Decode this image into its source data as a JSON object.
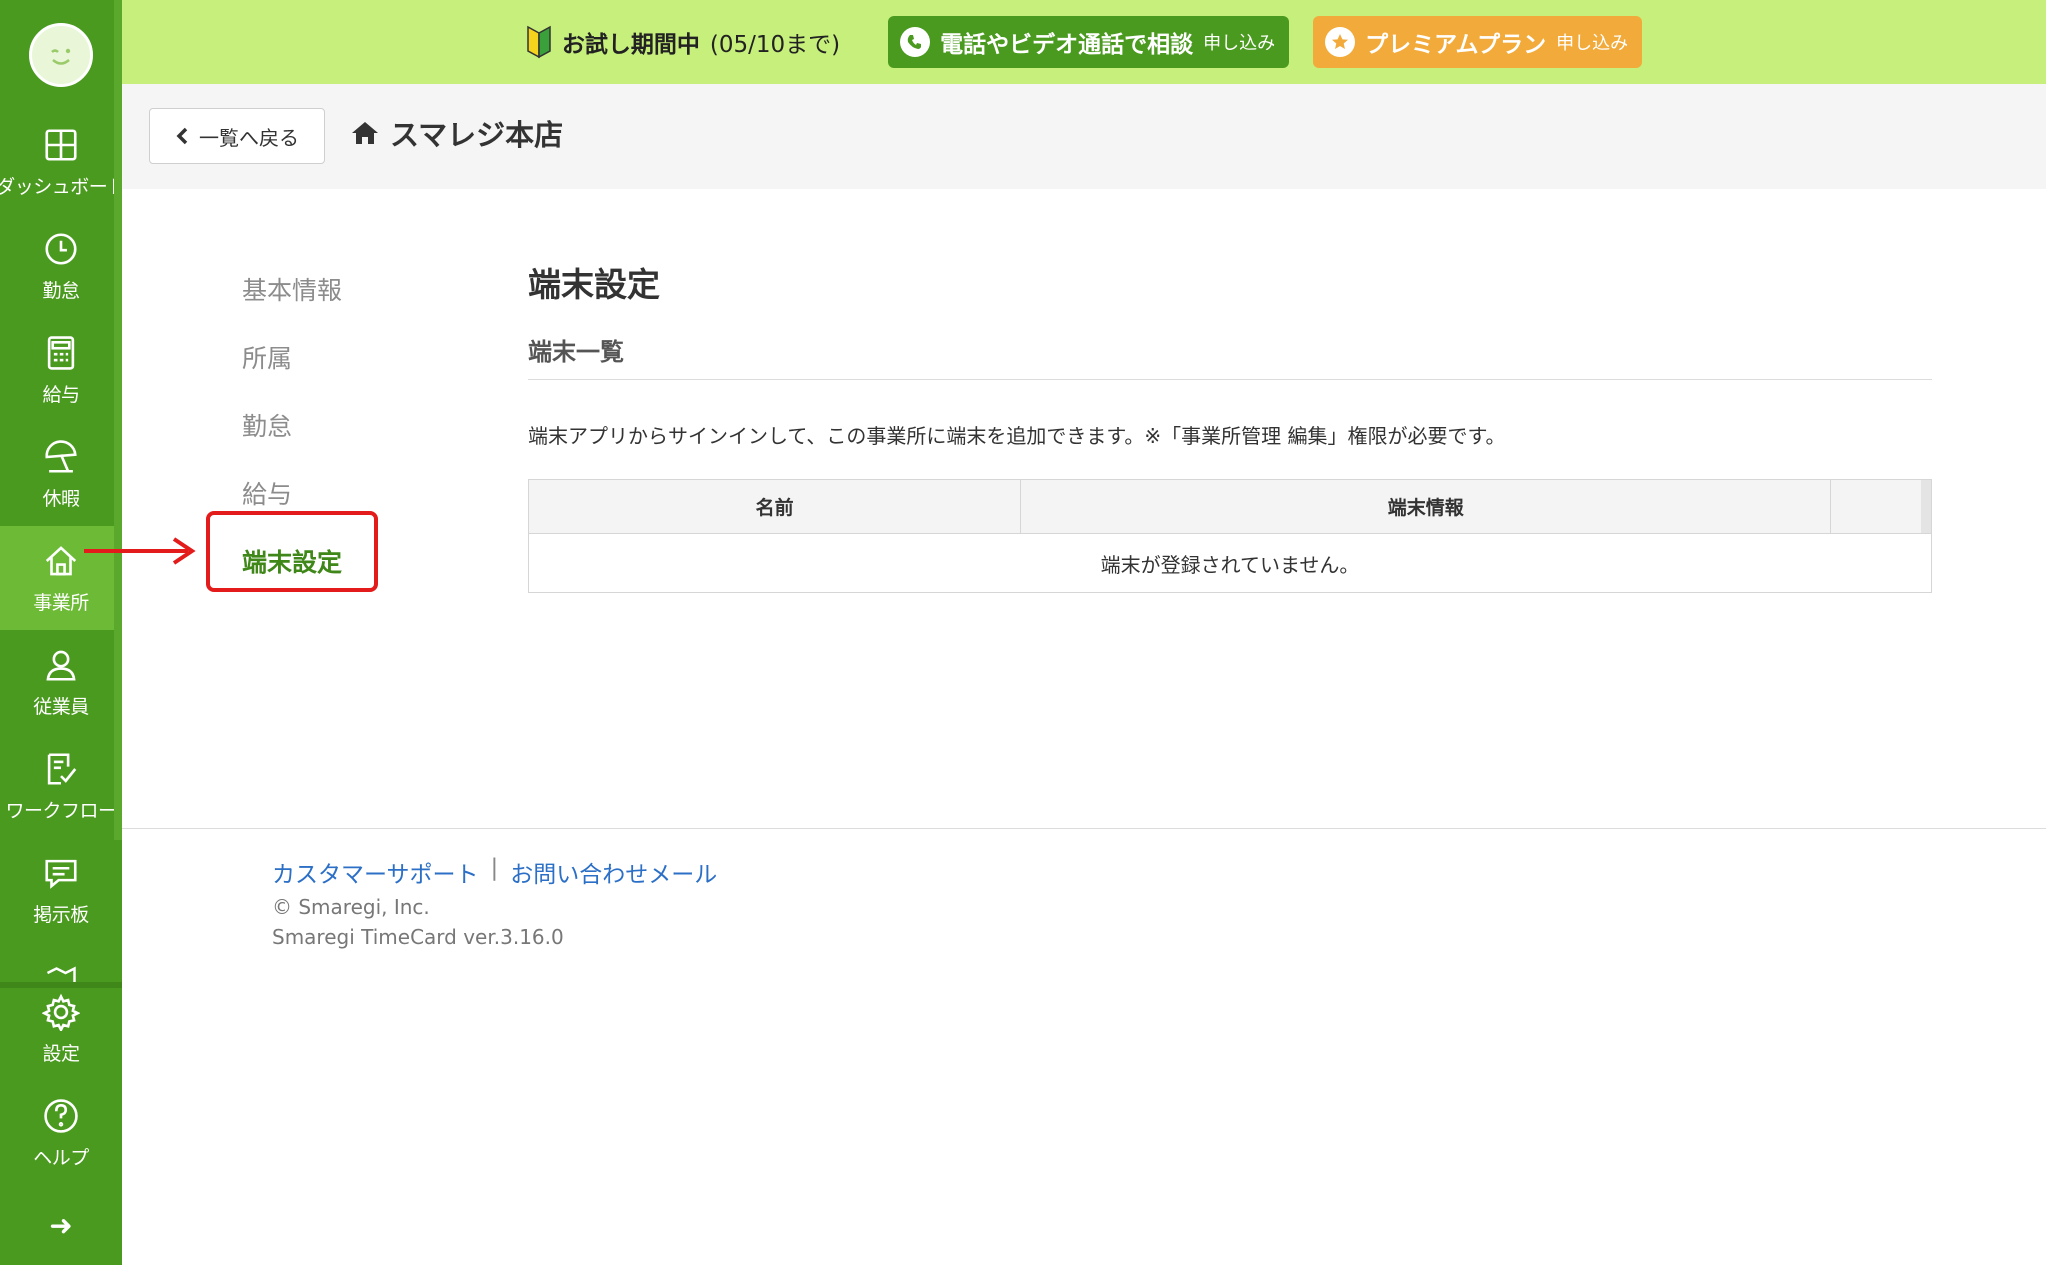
{
  "banner": {
    "trial_label": "お試し期間中",
    "trial_until": "(05/10まで)",
    "consult_label": "電話やビデオ通話で相談",
    "consult_sub": "申し込み",
    "premium_label": "プレミアムプラン",
    "premium_sub": "申し込み",
    "bg_color": "#c7ef7c",
    "green_color": "#4a9a1f",
    "orange_color": "#f2aa3a"
  },
  "sidebar": {
    "items": [
      {
        "label": "ダッシュボード",
        "icon": "dashboard-icon"
      },
      {
        "label": "勤怠",
        "icon": "clock-icon"
      },
      {
        "label": "給与",
        "icon": "calculator-icon"
      },
      {
        "label": "休暇",
        "icon": "umbrella-icon"
      },
      {
        "label": "事業所",
        "icon": "home-icon",
        "active": true
      },
      {
        "label": "従業員",
        "icon": "person-icon"
      },
      {
        "label": "ワークフロー",
        "icon": "checklist-icon"
      },
      {
        "label": "掲示板",
        "icon": "chat-icon"
      }
    ],
    "settings_label": "設定",
    "help_label": "ヘルプ",
    "expand_label": "➜"
  },
  "header": {
    "back_label": "一覧へ戻る",
    "store_name": "スマレジ本店"
  },
  "subnav": {
    "items": [
      "基本情報",
      "所属",
      "勤怠",
      "給与",
      "端末設定"
    ],
    "active": "端末設定"
  },
  "main": {
    "title": "端末設定",
    "section_title": "端末一覧",
    "description": "端末アプリからサインインして、この事業所に端末を追加できます。※「事業所管理 編集」権限が必要です。",
    "table": {
      "columns": [
        "名前",
        "端末情報",
        ""
      ],
      "empty_message": "端末が登録されていません。"
    }
  },
  "footer": {
    "support_link": "カスタマーサポート",
    "separator": "|",
    "contact_link": "お問い合わせメール",
    "copyright": "© Smaregi, Inc.",
    "version": "Smaregi TimeCard ver.3.16.0"
  }
}
